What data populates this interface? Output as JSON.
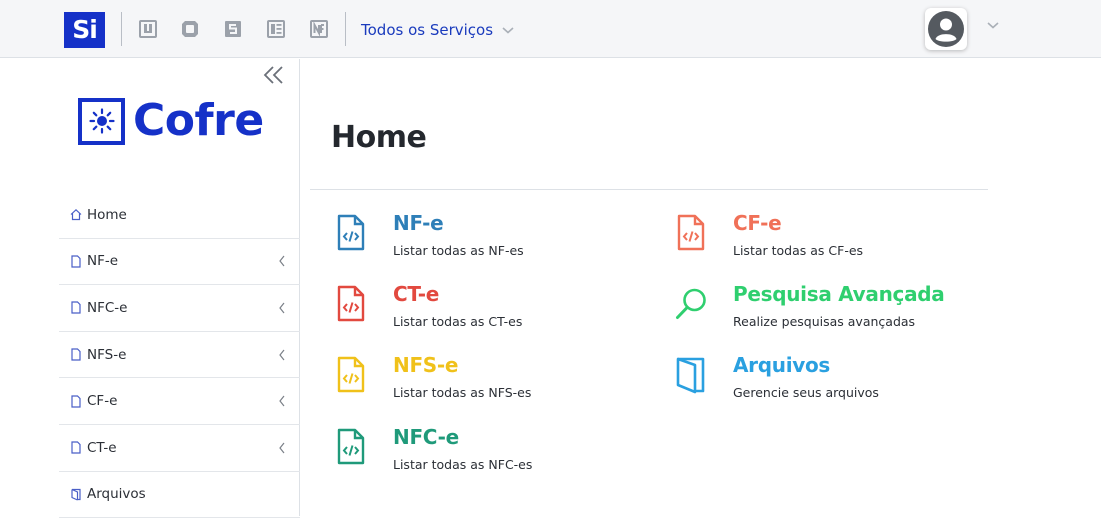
{
  "topbar": {
    "logo_text": "Si",
    "services_label": "Todos os Serviços",
    "app_icons": [
      "app-icon-1",
      "app-icon-2",
      "app-icon-3",
      "app-icon-4",
      "app-icon-5"
    ]
  },
  "sidebar": {
    "brand": "Cofre",
    "items": [
      {
        "label": "Home",
        "icon": "home-icon",
        "has_submenu": false
      },
      {
        "label": "NF-e",
        "icon": "document-icon",
        "has_submenu": true
      },
      {
        "label": "NFC-e",
        "icon": "document-icon",
        "has_submenu": true
      },
      {
        "label": "NFS-e",
        "icon": "document-icon",
        "has_submenu": true
      },
      {
        "label": "CF-e",
        "icon": "document-icon",
        "has_submenu": true
      },
      {
        "label": "CT-e",
        "icon": "document-icon",
        "has_submenu": true
      },
      {
        "label": "Arquivos",
        "icon": "folder-icon",
        "has_submenu": false
      }
    ]
  },
  "main": {
    "title": "Home",
    "cards": [
      {
        "title": "NF-e",
        "subtitle": "Listar todas as NF-es",
        "color": "#2e7fb8",
        "icon": "code-file-icon"
      },
      {
        "title": "CT-e",
        "subtitle": "Listar todas as CT-es",
        "color": "#e2493f",
        "icon": "code-file-icon"
      },
      {
        "title": "NFS-e",
        "subtitle": "Listar todas as NFS-es",
        "color": "#f0c11a",
        "icon": "code-file-icon"
      },
      {
        "title": "NFC-e",
        "subtitle": "Listar todas as NFC-es",
        "color": "#1f9a7a",
        "icon": "code-file-icon"
      },
      {
        "title": "CF-e",
        "subtitle": "Listar todas as CF-es",
        "color": "#f07158",
        "icon": "code-file-icon"
      },
      {
        "title": "Pesquisa Avançada",
        "subtitle": "Realize pesquisas avançadas",
        "color": "#2fcf6f",
        "icon": "search-icon"
      },
      {
        "title": "Arquivos",
        "subtitle": "Gerencie seus arquivos",
        "color": "#2aa0e0",
        "icon": "folder-icon"
      }
    ]
  },
  "colors": {
    "brand_blue": "#1531c8",
    "services_blue": "#1a3bbd",
    "topbar_bg": "#f5f6f8"
  }
}
